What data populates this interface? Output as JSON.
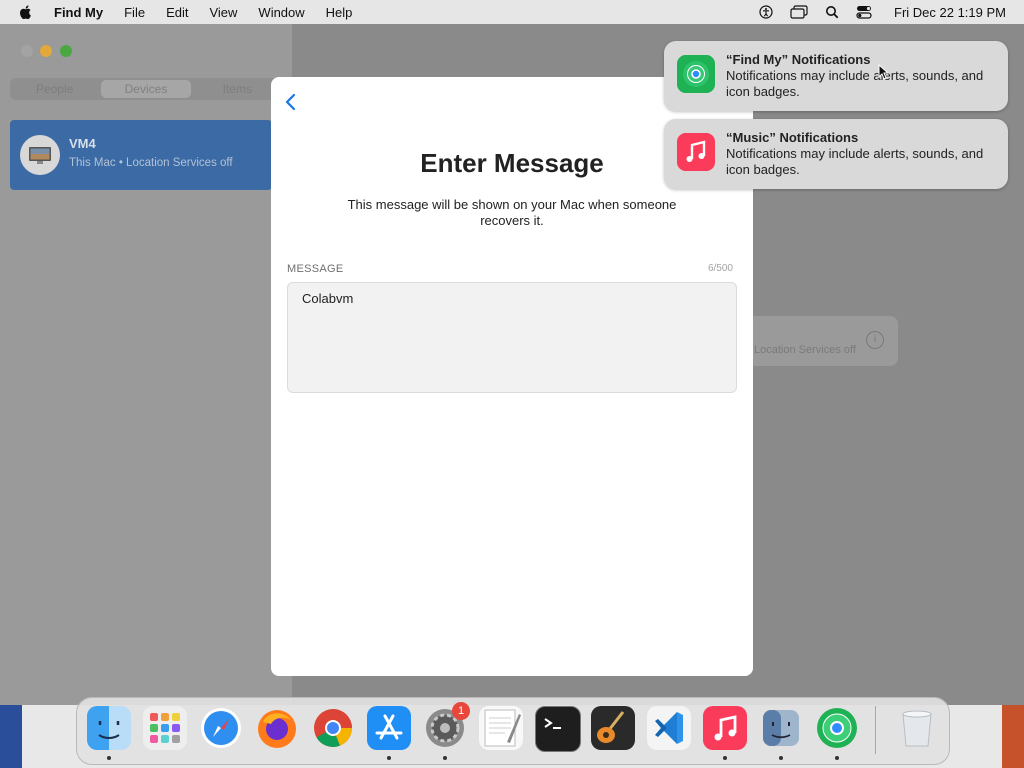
{
  "menubar": {
    "app_name": "Find My",
    "items": [
      "File",
      "Edit",
      "View",
      "Window",
      "Help"
    ],
    "clock": "Fri Dec 22  1:19 PM"
  },
  "sidebar": {
    "segments": [
      "People",
      "Devices",
      "Items"
    ],
    "device": {
      "name": "VM4",
      "subtitle": "This Mac • Location Services off"
    }
  },
  "background_card": {
    "subtitle": "Location Services off"
  },
  "dialog": {
    "title": "Enter Message",
    "description": "This message will be shown on your Mac when someone recovers it.",
    "field_label": "MESSAGE",
    "char_count": "6/500",
    "message_value": "Colabvm"
  },
  "notifications": [
    {
      "title": "“Find My” Notifications",
      "body": "Notifications may include alerts, sounds, and icon badges.",
      "icon": "find-my-icon"
    },
    {
      "title": "“Music” Notifications",
      "body": "Notifications may include alerts, sounds, and icon badges.",
      "icon": "music-icon"
    }
  ],
  "dock": {
    "apps": [
      {
        "name": "finder",
        "running": true
      },
      {
        "name": "launchpad",
        "running": false
      },
      {
        "name": "safari",
        "running": false
      },
      {
        "name": "firefox",
        "running": false
      },
      {
        "name": "chrome",
        "running": false
      },
      {
        "name": "app-store",
        "running": true
      },
      {
        "name": "system-settings",
        "running": true
      },
      {
        "name": "textedit",
        "running": false
      },
      {
        "name": "terminal",
        "running": false
      },
      {
        "name": "garageband",
        "running": false
      },
      {
        "name": "vscode",
        "running": false
      },
      {
        "name": "music",
        "running": true
      },
      {
        "name": "preview",
        "running": true
      },
      {
        "name": "find-my",
        "running": true
      },
      {
        "name": "trash",
        "running": false
      }
    ],
    "settings_badge": "1"
  },
  "colors": {
    "accent": "#1a73e8",
    "selection": "#3b6aa4",
    "badge": "#e8473c"
  }
}
